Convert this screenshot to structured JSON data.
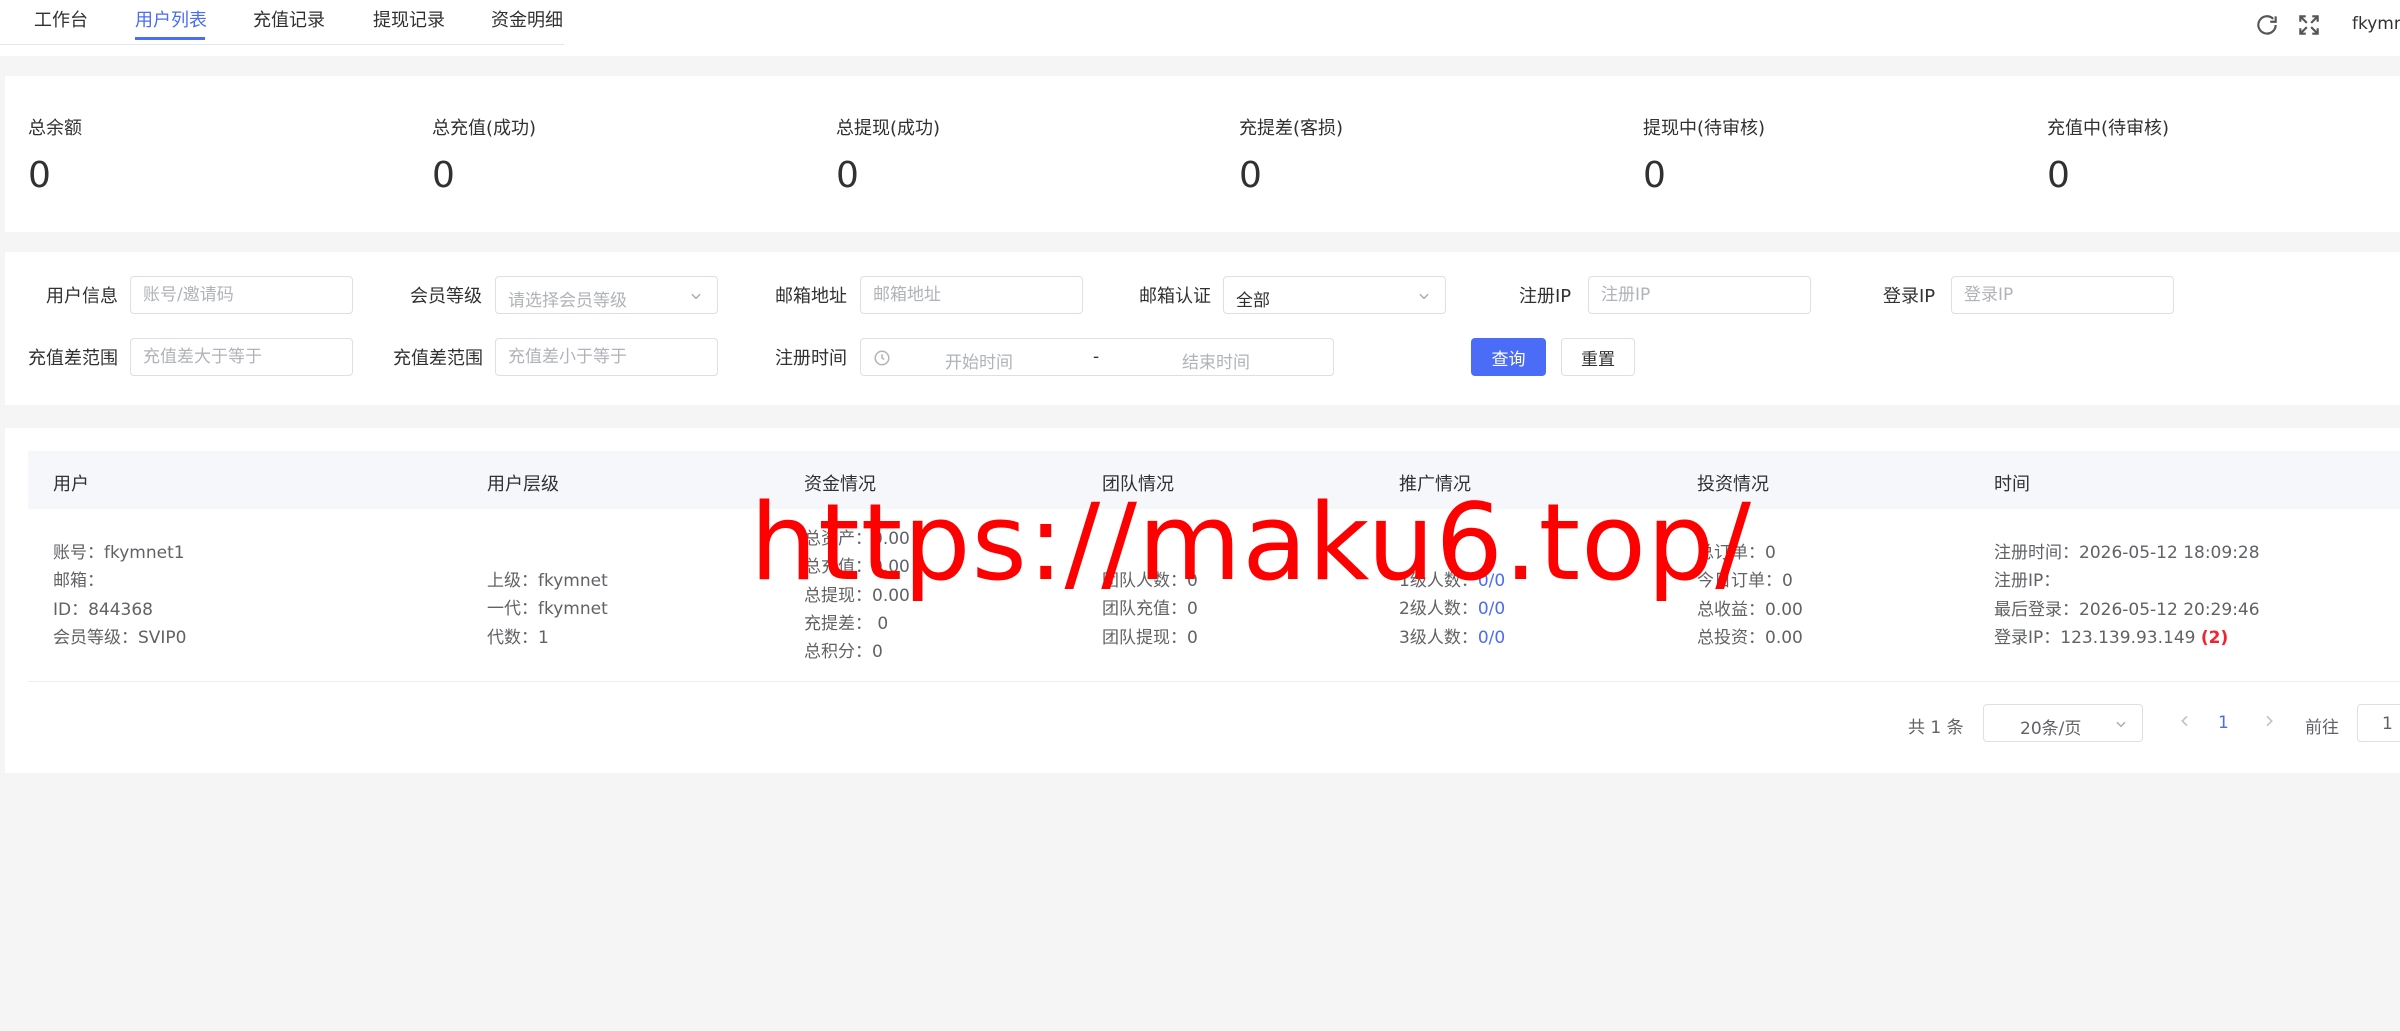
{
  "tabs": [
    {
      "label": "工作台",
      "active": false
    },
    {
      "label": "用户列表",
      "active": true
    },
    {
      "label": "充值记录",
      "active": false
    },
    {
      "label": "提现记录",
      "active": false
    },
    {
      "label": "资金明细",
      "active": false
    }
  ],
  "header": {
    "username": "fkymnet",
    "icons": [
      "refresh-icon",
      "fullscreen-icon"
    ]
  },
  "stats": [
    {
      "label": "总余额",
      "value": "0"
    },
    {
      "label": "总充值(成功)",
      "value": "0"
    },
    {
      "label": "总提现(成功)",
      "value": "0"
    },
    {
      "label": "充提差(客损)",
      "value": "0"
    },
    {
      "label": "提现中(待审核)",
      "value": "0"
    },
    {
      "label": "充值中(待审核)",
      "value": "0"
    }
  ],
  "filters": {
    "user_info": {
      "label": "用户信息",
      "placeholder": "账号/邀请码"
    },
    "member_level": {
      "label": "会员等级",
      "placeholder": "请选择会员等级"
    },
    "email": {
      "label": "邮箱地址",
      "placeholder": "邮箱地址"
    },
    "email_verify": {
      "label": "邮箱认证",
      "value": "全部"
    },
    "register_ip": {
      "label": "注册IP",
      "placeholder": "注册IP"
    },
    "login_ip": {
      "label": "登录IP",
      "placeholder": "登录IP"
    },
    "diff_min": {
      "label": "充值差范围",
      "placeholder": "充值差大于等于"
    },
    "diff_max": {
      "label": "充值差范围",
      "placeholder": "充值差小于等于"
    },
    "register_time": {
      "label": "注册时间",
      "start_placeholder": "开始时间",
      "separator": "-",
      "end_placeholder": "结束时间"
    },
    "query_label": "查询",
    "reset_label": "重置"
  },
  "table": {
    "columns": [
      "用户",
      "用户层级",
      "资金情况",
      "团队情况",
      "推广情况",
      "投资情况",
      "时间"
    ],
    "rows": [
      {
        "user": [
          "账号：fkymnet1",
          "邮箱：",
          "ID：844368",
          "会员等级：SVIP0"
        ],
        "level": [
          "上级：fkymnet",
          "一代：fkymnet",
          "代数：1"
        ],
        "funds": [
          "总资产：0.00",
          "总充值：0.00",
          "总提现：0.00",
          "充提差： 0",
          "总积分：0"
        ],
        "team": [
          "团队人数：0",
          "团队充值：0",
          "团队提现：0"
        ],
        "promo": [
          {
            "label": "1级人数：",
            "value": "0/0"
          },
          {
            "label": "2级人数：",
            "value": "0/0"
          },
          {
            "label": "3级人数：",
            "value": "0/0"
          }
        ],
        "invest": [
          "总订单：0",
          "今日订单：0",
          "总收益：0.00",
          "总投资：0.00"
        ],
        "time": {
          "register_time": "注册时间：2026-05-12 18:09:28",
          "register_ip": "注册IP：",
          "last_login": "最后登录：2026-05-12 20:29:46",
          "login_ip": "登录IP：123.139.93.149",
          "login_ip_count": "(2)"
        }
      }
    ]
  },
  "pagination": {
    "total": "共 1 条",
    "page_size": "20条/页",
    "current_page": "1",
    "goto_label": "前往",
    "goto_value": "1"
  },
  "watermark": "https://maku6.top/",
  "colors": {
    "accent": "#4a6cf7",
    "danger": "#f5222d",
    "watermark": "#ff0000"
  }
}
